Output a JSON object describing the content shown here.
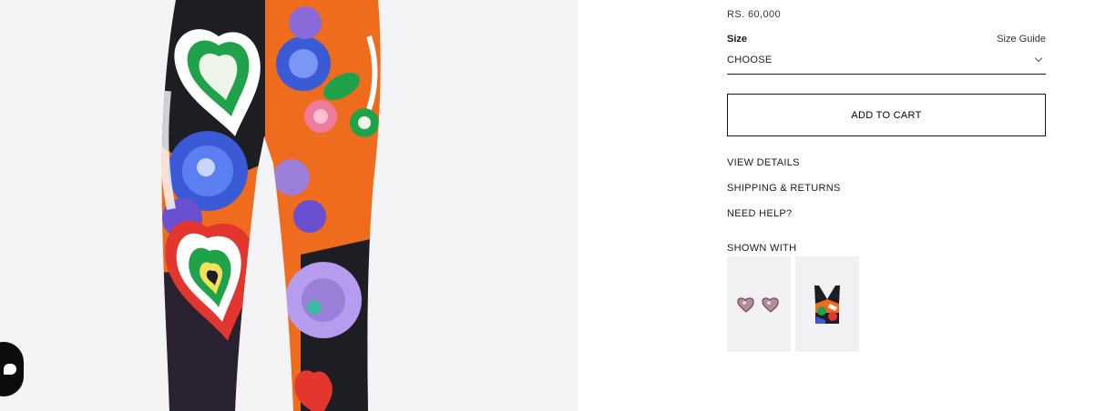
{
  "product": {
    "price": "RS. 60,000",
    "image_icon": "product-photo-printed-leggings"
  },
  "size": {
    "label": "Size",
    "guide_link": "Size Guide",
    "selected": "CHOOSE"
  },
  "actions": {
    "add_to_cart": "ADD TO CART"
  },
  "info_links": {
    "view_details": "VIEW DETAILS",
    "shipping_returns": "SHIPPING & RETURNS",
    "need_help": "NEED HELP?"
  },
  "shown_with": {
    "title": "SHOWN WITH",
    "items": [
      {
        "icon": "heart-earrings-thumbnail"
      },
      {
        "icon": "printed-top-thumbnail"
      }
    ]
  },
  "colors": {
    "text": "#1a1a1a",
    "image_bg": "#f4f3f6",
    "print_orange": "#ef6b1e",
    "print_green": "#1fa24a",
    "print_blue": "#3b5bd6",
    "print_purple": "#9b7fd8",
    "print_pink": "#f07a9a",
    "print_red": "#e2362f"
  }
}
